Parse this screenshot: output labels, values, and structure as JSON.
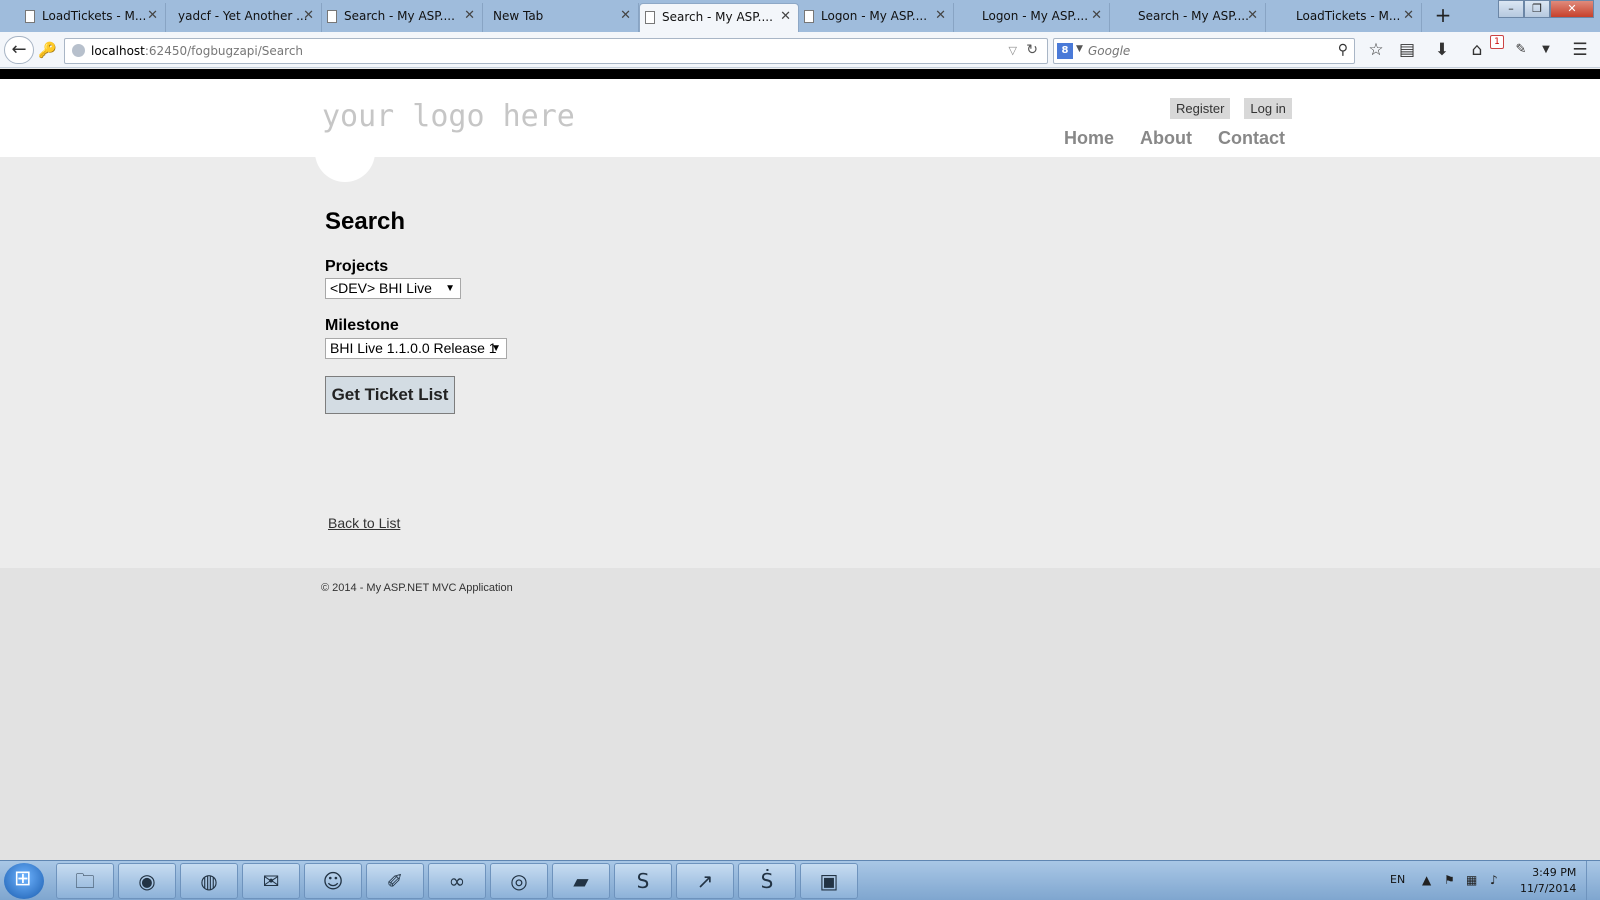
{
  "browser": {
    "tabs": [
      {
        "title": "LoadTickets - M...",
        "active": false
      },
      {
        "title": "yadcf - Yet Another ...",
        "active": false
      },
      {
        "title": "Search - My ASP....",
        "active": false
      },
      {
        "title": "New Tab",
        "active": false
      },
      {
        "title": "Search - My ASP....",
        "active": true
      },
      {
        "title": "Logon - My ASP....",
        "active": false
      },
      {
        "title": "Logon - My ASP....",
        "active": false
      },
      {
        "title": "Search - My ASP....",
        "active": false
      },
      {
        "title": "LoadTickets - M...",
        "active": false
      }
    ],
    "url_host": "localhost",
    "url_rest": ":62450/fogbugzapi/Search",
    "search_placeholder": "Google",
    "notification_count": "1"
  },
  "site": {
    "logo": "your logo here",
    "auth_links": {
      "register": "Register",
      "login": "Log in"
    },
    "menu": {
      "home": "Home",
      "about": "About",
      "contact": "Contact"
    }
  },
  "page": {
    "title": "Search",
    "projects_label": "Projects",
    "projects_selected": "<DEV> BHI Live",
    "milestone_label": "Milestone",
    "milestone_selected": "BHI Live 1.1.0.0 Release 1",
    "submit_label": "Get Ticket List",
    "back_link": "Back to List",
    "footer": "© 2014 - My ASP.NET MVC Application"
  },
  "taskbar": {
    "apps": [
      "file-explorer-icon",
      "chrome-icon",
      "firefox-icon",
      "outlook-icon",
      "pidgin-icon",
      "paint-icon",
      "visual-studio-icon",
      "network-icon",
      "sticky-notes-icon",
      "skype-icon",
      "monitor-chart-icon",
      "sublime-text-icon",
      "terminal-icon"
    ],
    "language": "EN",
    "time": "3:49 PM",
    "date": "11/7/2014"
  }
}
